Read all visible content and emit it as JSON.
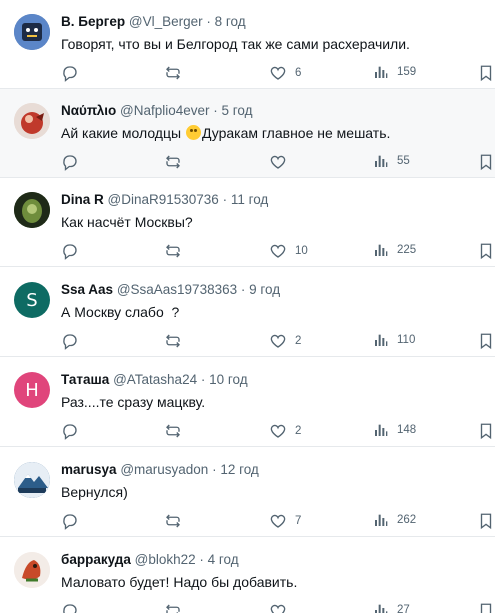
{
  "tweets": [
    {
      "name": "В. Бергер",
      "handle": "@Vl_Berger",
      "time": "8 год",
      "text": "Говорят, что вы и Белгород так же сами расхерачили.",
      "replies": "",
      "retweets": "",
      "likes": "6",
      "views": "159",
      "avatar_letter": "",
      "avatar_color": "#4a6ea8"
    },
    {
      "name": "Ναύπλιο",
      "handle": "@Nafplio4ever",
      "time": "5 год",
      "text_before": "Ай какие молодцы ",
      "text_after": "Дуракам главное не мешать.",
      "replies": "",
      "retweets": "",
      "likes": "",
      "views": "55",
      "avatar_letter": "",
      "avatar_color": "#c0392b"
    },
    {
      "name": "Dina R",
      "handle": "@DinaR91530736",
      "time": "11 год",
      "text": "Как насчёт Москвы?",
      "replies": "",
      "retweets": "",
      "likes": "10",
      "views": "225",
      "avatar_letter": "",
      "avatar_color": "#2f4f1f"
    },
    {
      "name": "Ssa Aas",
      "handle": "@SsaAas19738363",
      "time": "9 год",
      "text": "А Москву слабо  ?",
      "replies": "",
      "retweets": "",
      "likes": "2",
      "views": "110",
      "avatar_letter": "S",
      "avatar_color": "#0e6b63"
    },
    {
      "name": "Таташа",
      "handle": "@ATatasha24",
      "time": "10 год",
      "text": "Раз....те сразу мацкву.",
      "replies": "",
      "retweets": "",
      "likes": "2",
      "views": "148",
      "avatar_letter": "H",
      "avatar_color": "#e0457b"
    },
    {
      "name": "marusya",
      "handle": "@marusyadon",
      "time": "12 год",
      "text": "Вернулся)",
      "replies": "",
      "retweets": "",
      "likes": "7",
      "views": "262",
      "avatar_letter": "",
      "avatar_color": "#2c5d8a"
    },
    {
      "name": "барракуда",
      "handle": "@blokh22",
      "time": "4 год",
      "text": "Маловато будет! Надо бы добавить.",
      "replies": "",
      "retweets": "",
      "likes": "",
      "views": "27",
      "avatar_letter": "",
      "avatar_color": "#c84a2a"
    }
  ],
  "colors": {
    "text": "#0f1419",
    "secondary": "#536471",
    "highlight_bg": "#f7f8f9",
    "divider": "#e6e9ec"
  },
  "icons": {
    "reply": "reply-icon",
    "retweet": "retweet-icon",
    "like": "heart-icon",
    "views": "views-icon",
    "bookmark": "bookmark-icon"
  }
}
